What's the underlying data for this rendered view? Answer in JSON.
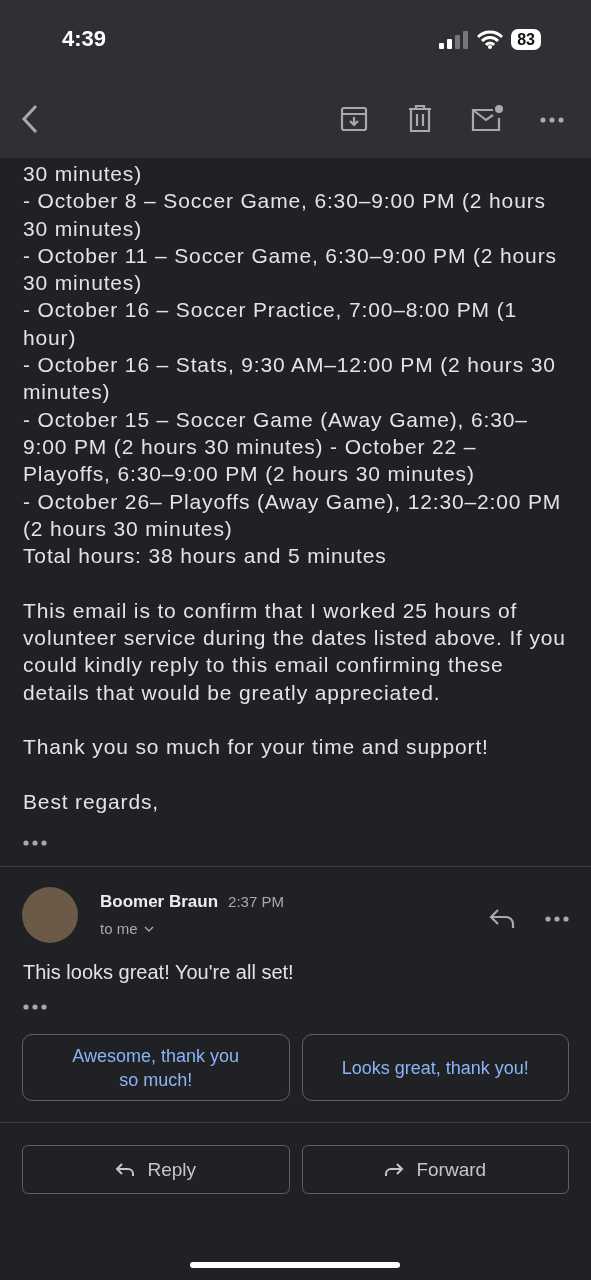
{
  "status_bar": {
    "time": "4:39",
    "battery": "83"
  },
  "message_1": {
    "lines": [
      "30 minutes)",
      "- October 8 – Soccer Game, 6:30–9:00 PM (2 hours 30 minutes)",
      "- October 11 – Soccer Game, 6:30–9:00 PM (2 hours 30 minutes)",
      "- October 16 – Soccer Practice, 7:00–8:00 PM (1 hour)",
      "- October 16 – Stats, 9:30 AM–12:00 PM (2 hours 30 minutes)",
      "- October 15 – Soccer Game (Away Game), 6:30–9:00 PM (2 hours 30 minutes)  - October 22 – Playoffs, 6:30–9:00 PM (2 hours 30 minutes)",
      "- October 26– Playoffs (Away Game), 12:30–2:00 PM (2 hours 30 minutes)",
      "Total hours: 38 hours and 5 minutes"
    ],
    "paragraphs": [
      "This email is to confirm that I worked 25 hours of volunteer service during the dates listed above. If you could kindly reply to this email confirming these details that would be greatly appreciated.",
      "Thank you so much for your time and support!",
      "Best regards,"
    ]
  },
  "message_2": {
    "sender": "Boomer Braun",
    "time": "2:37 PM",
    "recipient": "to me",
    "body": "This looks great! You're all set!"
  },
  "smart_replies": [
    "Awesome, thank you so much!",
    "Looks great, thank you!"
  ],
  "actions": [
    {
      "label": "Reply",
      "kind": "reply"
    },
    {
      "label": "Forward",
      "kind": "forward"
    }
  ]
}
